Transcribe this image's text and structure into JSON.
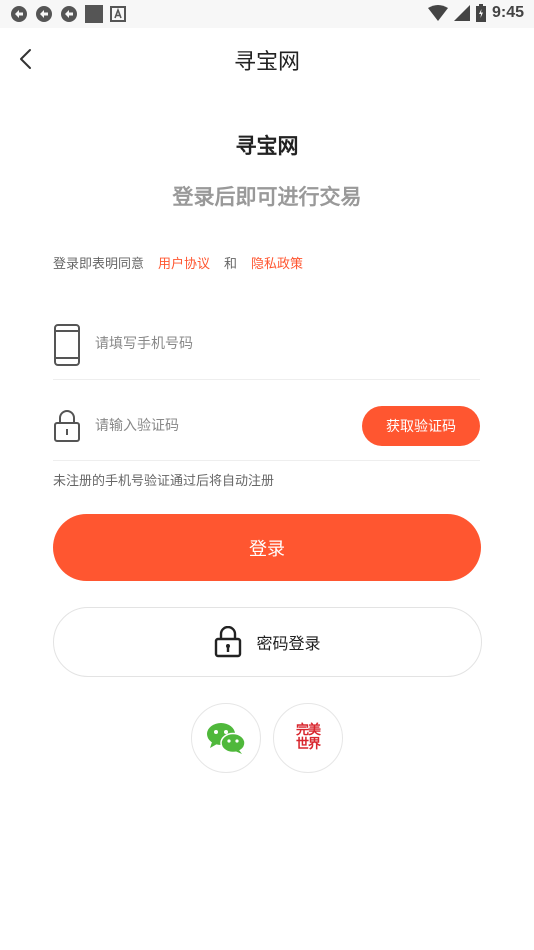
{
  "status_bar": {
    "time": "9:45",
    "icons": [
      "sync-icon",
      "sync-icon",
      "sync-icon",
      "stop-square-icon",
      "font-a-icon",
      "wifi-icon",
      "cell-signal-icon",
      "battery-icon"
    ]
  },
  "header": {
    "title": "寻宝网",
    "back_icon": "chevron-left-icon"
  },
  "brand": {
    "name": "寻宝网",
    "subtitle": "登录后即可进行交易"
  },
  "agreement": {
    "prefix": "登录即表明同意",
    "user_agreement": "用户协议",
    "conjunction": "和",
    "privacy_policy": "隐私政策"
  },
  "form": {
    "phone_placeholder": "请填写手机号码",
    "code_placeholder": "请输入验证码",
    "get_code_label": "获取验证码",
    "hint": "未注册的手机号验证通过后将自动注册",
    "login_label": "登录",
    "password_login_label": "密码登录"
  },
  "social_login": {
    "wechat": "wechat-icon",
    "perfect_world_logo_text": "完美世界"
  },
  "colors": {
    "accent": "#ff5630",
    "muted_text": "#999999",
    "body_text": "#222222",
    "link": "#ff5630",
    "wechat_green": "#4fb83b",
    "perfect_world_red": "#d8262e"
  }
}
